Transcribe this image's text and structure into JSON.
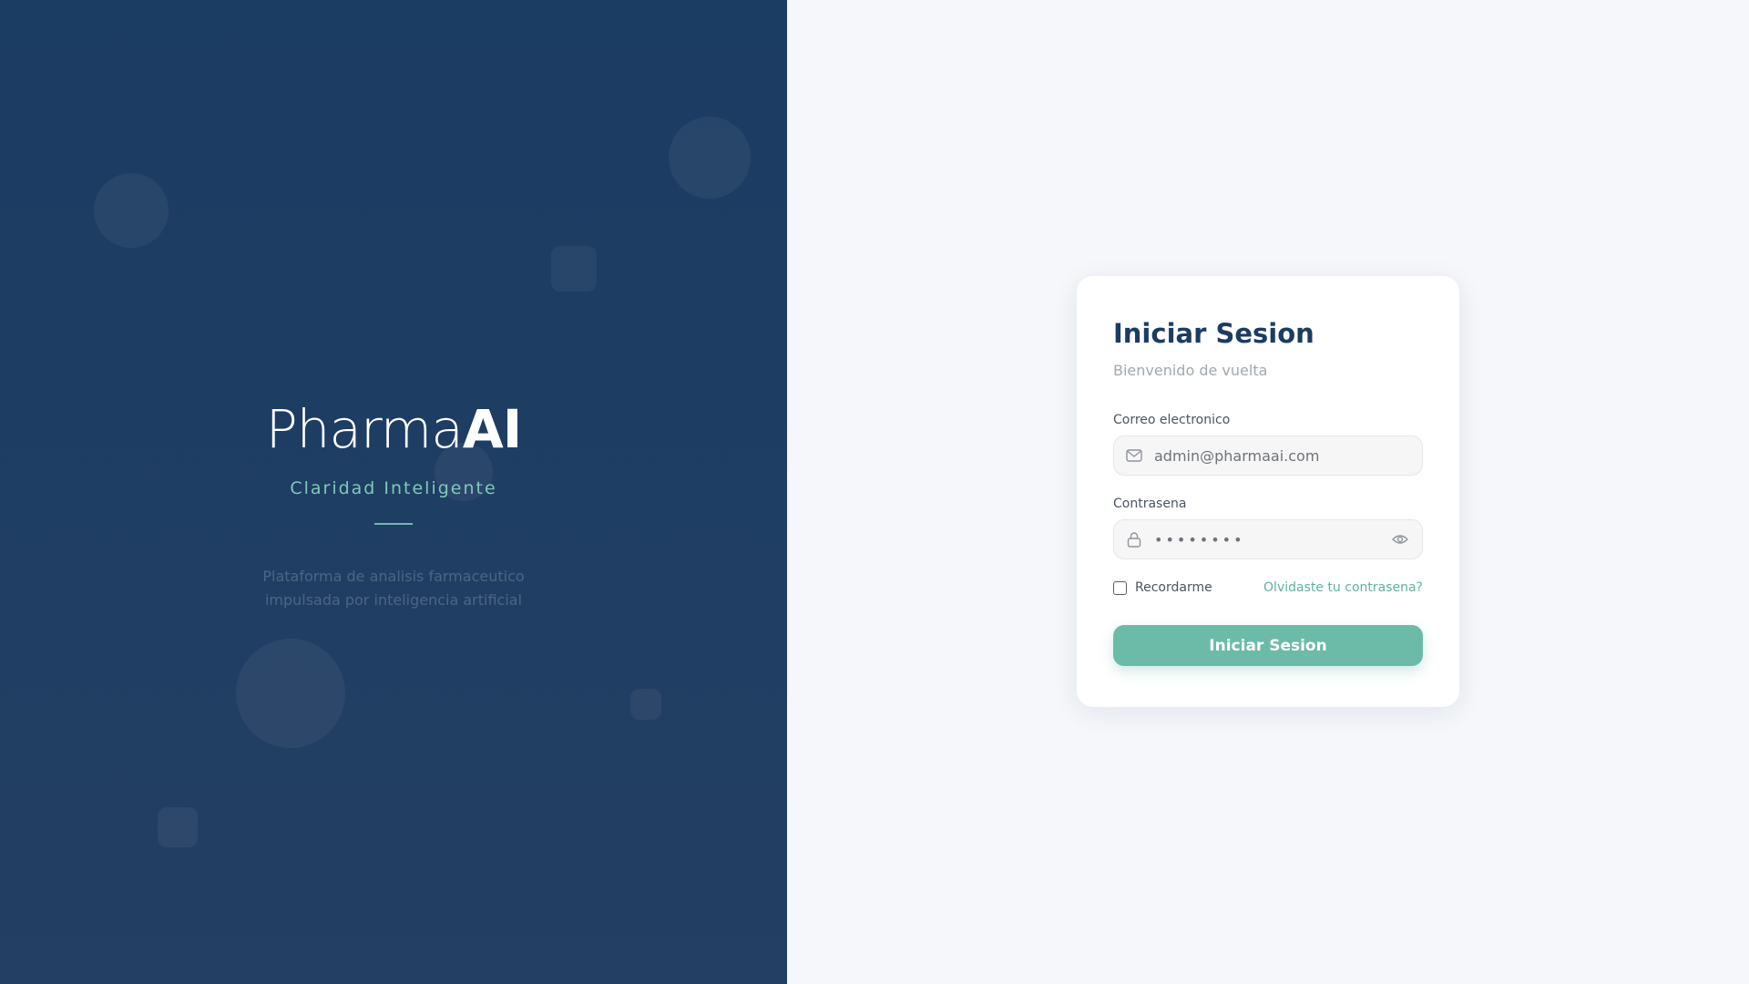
{
  "brand": {
    "logo_light": "Pharma",
    "logo_bold": "AI",
    "tagline": "Claridad Inteligente",
    "description_line1": "Plataforma de analisis farmaceutico",
    "description_line2": "impulsada por inteligencia artificial"
  },
  "login": {
    "title": "Iniciar Sesion",
    "subtitle": "Bienvenido de vuelta",
    "email_label": "Correo electronico",
    "email_value": "admin@pharmaai.com",
    "email_icon": "mail-icon",
    "password_label": "Contrasena",
    "password_value": "••••••••",
    "password_icon": "lock-icon",
    "toggle_icon": "eye-icon",
    "remember_label": "Recordarme",
    "remember_checked": false,
    "forgot_link": "Olvidaste tu contrasena?",
    "submit_label": "Iniciar Sesion"
  },
  "colors": {
    "navy": "#1b3c63",
    "accent": "#6cbba9",
    "background": "#f5f7fa"
  }
}
